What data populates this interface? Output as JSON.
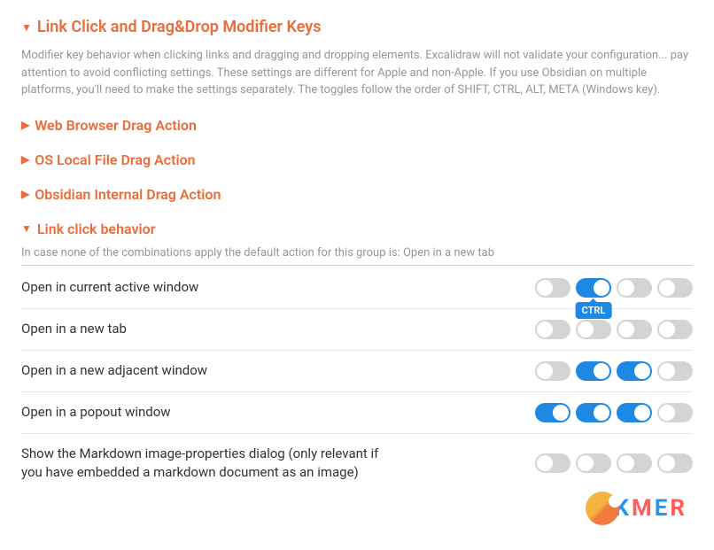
{
  "header": {
    "title": "Link Click and Drag&Drop Modifier Keys",
    "description": "Modifier key behavior when clicking links and dragging and dropping elements. Excalidraw will not validate your configuration... pay attention to avoid conflicting settings. These settings are different for Apple and non-Apple. If you use Obsidian on multiple platforms, you'll need to make the settings separately. The toggles follow the order of SHIFT, CTRL, ALT, META (Windows key)."
  },
  "sections": [
    {
      "id": "web",
      "title": "Web Browser Drag Action",
      "expanded": false
    },
    {
      "id": "os",
      "title": "OS Local File Drag Action",
      "expanded": false
    },
    {
      "id": "obsidian",
      "title": "Obsidian Internal Drag Action",
      "expanded": false
    },
    {
      "id": "link",
      "title": "Link click behavior",
      "expanded": true,
      "hint": "In case none of the combinations apply the default action for this group is: Open in a new tab",
      "rows": [
        {
          "label": "Open in current active window",
          "toggles": [
            false,
            true,
            false,
            false
          ],
          "tooltipIdx": 1,
          "tooltip": "CTRL"
        },
        {
          "label": "Open in a new tab",
          "toggles": [
            false,
            false,
            false,
            false
          ]
        },
        {
          "label": "Open in a new adjacent window",
          "toggles": [
            false,
            true,
            true,
            false
          ]
        },
        {
          "label": "Open in a popout window",
          "toggles": [
            true,
            true,
            true,
            false
          ]
        },
        {
          "label": "Show the Markdown image-properties dialog (only relevant if you have embedded a markdown document as an image)",
          "toggles": [
            false,
            false,
            false,
            false
          ]
        }
      ]
    }
  ],
  "watermark": {
    "letters": [
      "K",
      "M",
      "E",
      "R"
    ]
  }
}
